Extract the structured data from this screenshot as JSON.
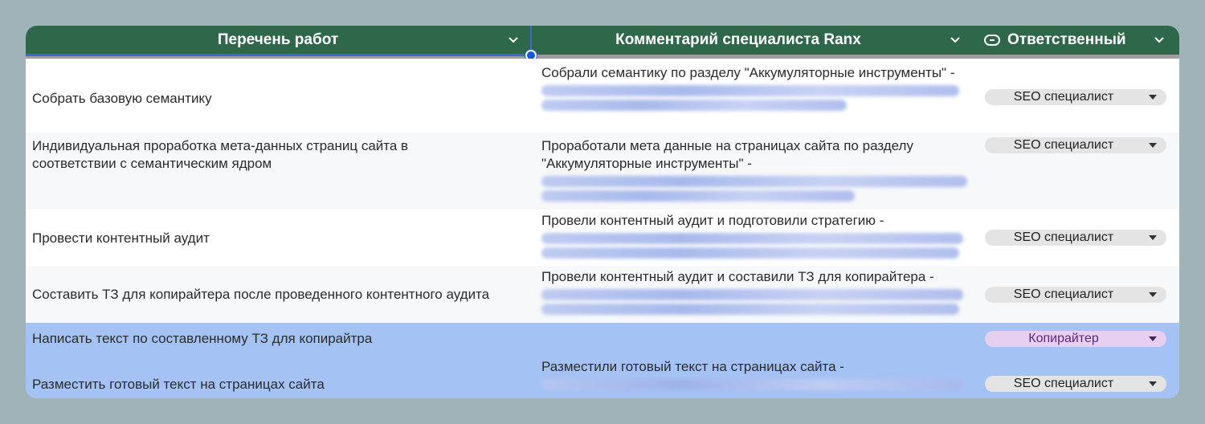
{
  "header": {
    "col1_title": "Перечень работ",
    "col2_title": "Комментарий специалиста Ranx",
    "col3_title": "Ответственный",
    "col3_icon": "tag-icon",
    "dropdown_icon": "chevron-down-icon"
  },
  "colors": {
    "header_bg": "#2e6749",
    "selected_row_bg": "#a4c2f4",
    "alt_row_bg": "#f7f8fa",
    "chip_gray": "#e4e4e4",
    "chip_purple": "#e6cff0",
    "page_bg": "#9fb3b9"
  },
  "rows": [
    {
      "task": "Собрать базовую семантику",
      "comment": "Собрали семантику по разделу \"Аккумуляторные инструменты\" -",
      "responsible": "SEO специалист"
    },
    {
      "task": "Индивидуальная проработка мета-данных страниц сайта в соответствии с семантическим ядром",
      "comment": "Проработали мета данные на страницах сайта по разделу \"Аккумуляторные инструменты\" -",
      "responsible": "SEO специалист"
    },
    {
      "task": "Провести контентный аудит",
      "comment": "Провели контентный аудит и подготовили стратегию -",
      "responsible": "SEO специалист"
    },
    {
      "task": "Составить ТЗ для копирайтера после проведенного контентного аудита",
      "comment": "Провели контентный аудит и составили ТЗ для копирайтера -",
      "responsible": "SEO специалист"
    },
    {
      "task": "Написать текст по составленному ТЗ для копирайтра",
      "comment": "",
      "responsible": "Копирайтер"
    },
    {
      "task": "Разместить готовый текст на страницах сайта",
      "comment": "Разместили готовый текст на страницах сайта -",
      "responsible": "SEO специалист"
    }
  ]
}
